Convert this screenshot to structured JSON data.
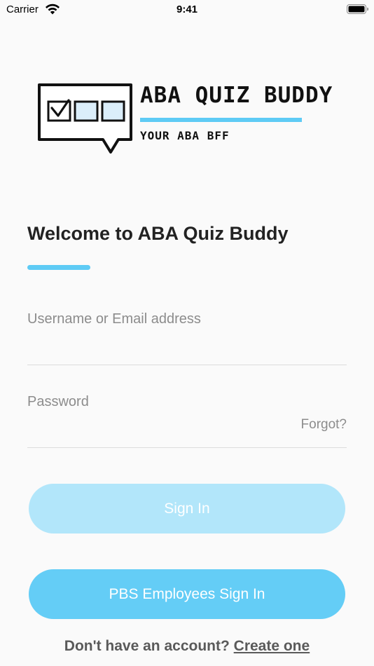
{
  "status_bar": {
    "carrier": "Carrier",
    "time": "9:41"
  },
  "logo": {
    "title": "ABA QUIZ BUDDY",
    "tagline": "YOUR ABA BFF",
    "accent_color": "#5ecbf5"
  },
  "welcome": {
    "title": "Welcome to ABA Quiz Buddy"
  },
  "form": {
    "username_placeholder": "Username or Email address",
    "username_value": "",
    "password_placeholder": "Password",
    "password_value": "",
    "forgot_label": "Forgot?"
  },
  "buttons": {
    "sign_in_label": "Sign In",
    "pbs_sign_in_label": "PBS Employees Sign In"
  },
  "signup": {
    "prompt": "Don't have an account?",
    "link_label": "Create one"
  },
  "colors": {
    "primary": "#64cdf6",
    "primary_disabled": "#b2e6fa",
    "background": "#fafafa"
  },
  "icons": {
    "wifi": "wifi-icon",
    "battery": "battery-icon",
    "logo": "chat-checkbox-logo"
  }
}
